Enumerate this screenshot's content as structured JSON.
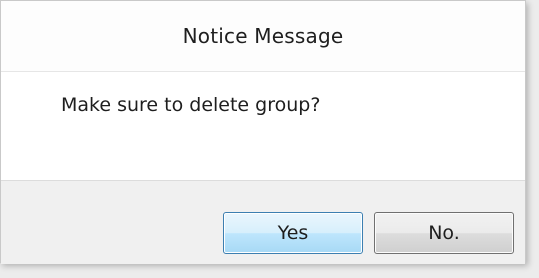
{
  "dialog": {
    "title": "Notice Message",
    "message": "Make sure to delete group?",
    "buttons": {
      "yes_label": "Yes",
      "no_label": "No."
    }
  },
  "colors": {
    "primary_button_border": "#3c7fb1",
    "primary_button_fill": "#bee6fd",
    "secondary_button_border": "#707070",
    "content_background": "#ffffff",
    "footer_background": "#f0f0f0"
  }
}
